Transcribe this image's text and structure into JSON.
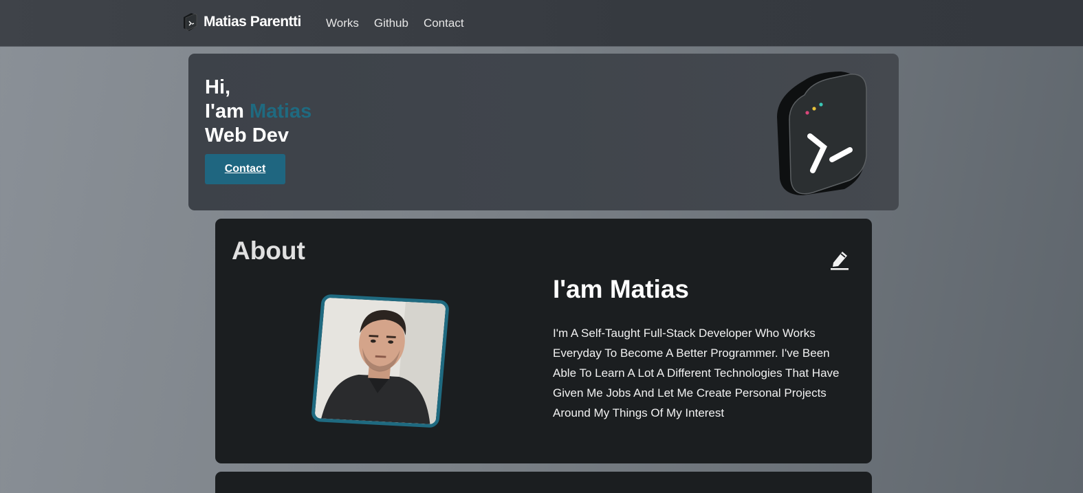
{
  "nav": {
    "brand_name": "Matias Parentti",
    "links": [
      "Works",
      "Github",
      "Contact"
    ]
  },
  "hero": {
    "line1": "Hi,",
    "line2_prefix": "I'am ",
    "line2_accent": "Matias",
    "line3": "Web Dev",
    "button_label": "Contact"
  },
  "about": {
    "title": "About",
    "heading": "I'am Matias",
    "body": "I'm A Self-Taught Full-Stack Developer Who Works Everyday To Become A Better Programmer. I've Been Able To Learn A Lot A Different Technologies That Have Given Me Jobs And Let Me Create Personal Projects Around My Things Of My Interest"
  },
  "colors": {
    "accent": "#1f6a80",
    "card_bg": "#1b1e20",
    "nav_bg": "#3a3e44"
  },
  "icons": {
    "brand": "terminal-logo-icon",
    "hero": "terminal-logo-icon",
    "edit": "pencil-icon"
  }
}
